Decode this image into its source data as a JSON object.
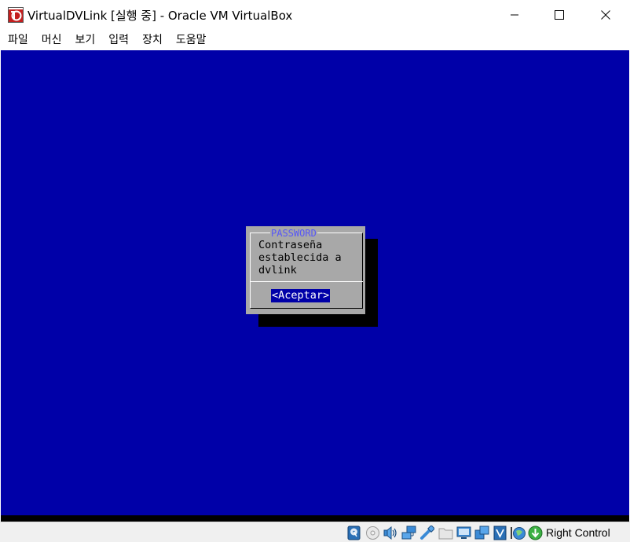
{
  "window": {
    "title": "VirtualDVLink [실행 중] - Oracle VM VirtualBox",
    "app_icon": "virtualbox-machine-icon",
    "controls": [
      "minimize-icon",
      "maximize-icon",
      "close-icon"
    ]
  },
  "menubar": {
    "items": [
      {
        "label": "파일"
      },
      {
        "label": "머신"
      },
      {
        "label": "보기"
      },
      {
        "label": "입력"
      },
      {
        "label": "장치"
      },
      {
        "label": "도움말"
      }
    ]
  },
  "vm": {
    "background_color": "#0000a8",
    "dialog": {
      "title": "PASSWORD",
      "message_lines": [
        "Contraseña",
        "establecida a",
        "dvlink"
      ],
      "button_label": "<Aceptar>"
    }
  },
  "statusbar": {
    "icons": [
      "hard-disk-icon",
      "optical-drive-icon",
      "audio-icon",
      "network-icon",
      "usb-icon",
      "shared-folders-icon",
      "display-icon",
      "video-capture-icon",
      "virtualization-icon",
      "mouse-integration-icon",
      "keyboard-capture-icon"
    ],
    "host_key_label": "Right Control"
  },
  "colors": {
    "vm_blue": "#0000a8",
    "dialog_gray": "#a8a8a8",
    "dialog_title": "#5656f8",
    "button_highlight": "#0000a8"
  }
}
